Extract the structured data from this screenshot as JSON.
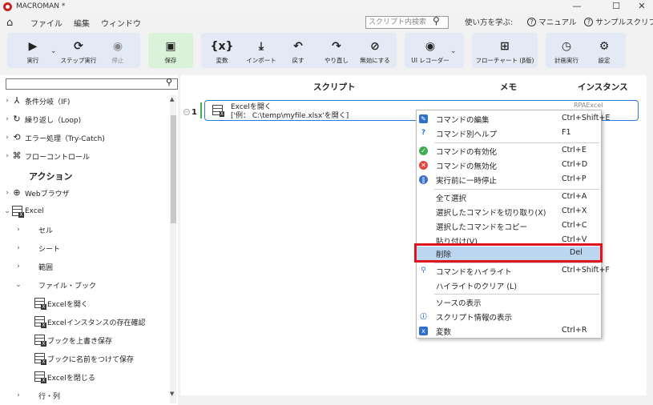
{
  "window": {
    "title": "MACROMAN *",
    "controls": [
      "—",
      "☐",
      "✕"
    ]
  },
  "menubar": {
    "items": [
      "ファイル",
      "編集",
      "ウィンドウ"
    ],
    "search_placeholder": "スクリプト内検索",
    "learn_label": "使い方を学ぶ:",
    "manual_label": "マニュアル",
    "sample_label": "サンプルスクリプト"
  },
  "toolbar": {
    "run": "実行",
    "step_run": "ステップ実行",
    "stop": "停止",
    "save": "保存",
    "variables": "変数",
    "import": "インポート",
    "undo": "戻す",
    "redo": "やり直し",
    "disable": "無効にする",
    "ui_recorder": "UI レコーダー",
    "flowchart": "フローチャート (β版)",
    "schedule": "計画実行",
    "settings": "設定"
  },
  "leftpanel": {
    "categories": [
      "条件分岐（IF)",
      "繰り返し（Loop)",
      "エラー処理（Try-Catch)",
      "フローコントロール"
    ],
    "actions_title": "アクション",
    "web_browser": "Webブラウザ",
    "excel": "Excel",
    "excel_children": [
      "セル",
      "シート",
      "範囲",
      "ファイル・ブック"
    ],
    "file_book_children": [
      "Excelを開く",
      "Excelインスタンスの存在確認",
      "ブックを上書き保存",
      "ブックに名前をつけて保存",
      "Excelを閉じる"
    ],
    "rows_cols": "行・列"
  },
  "script": {
    "col_script": "スクリプト",
    "col_memo": "メモ",
    "col_instance": "インスタンス",
    "line_number": "1",
    "command_title": "Excelを開く",
    "command_param": "['例： C:\\temp\\myfile.xlsx'を開く]",
    "instance": "RPAExcel"
  },
  "context_menu": {
    "items": [
      {
        "label": "コマンドの編集",
        "shortcut": "Ctrl+Shift+E"
      },
      {
        "label": "コマンド別ヘルプ",
        "shortcut": "F1"
      },
      {
        "label": "コマンドの有効化",
        "shortcut": "Ctrl+E"
      },
      {
        "label": "コマンドの無効化",
        "shortcut": "Ctrl+D"
      },
      {
        "label": "実行前に一時停止",
        "shortcut": "Ctrl+P"
      },
      {
        "label": "全て選択",
        "shortcut": "Ctrl+A"
      },
      {
        "label": "選択したコマンドを切り取り(X)",
        "shortcut": "Ctrl+X"
      },
      {
        "label": "選択したコマンドをコピー",
        "shortcut": "Ctrl+C"
      },
      {
        "label": "貼り付け(V)",
        "shortcut": "Ctrl+V"
      },
      {
        "label": "削除",
        "shortcut": "Del"
      },
      {
        "label": "コマンドをハイライト",
        "shortcut": "Ctrl+Shift+F"
      },
      {
        "label": "ハイライトのクリア (L)",
        "shortcut": ""
      },
      {
        "label": "ソースの表示",
        "shortcut": ""
      },
      {
        "label": "スクリプト情報の表示",
        "shortcut": ""
      },
      {
        "label": "変数",
        "shortcut": "Ctrl+R"
      }
    ],
    "highlighted": "削除"
  },
  "colors": {
    "accent_blue": "#2b7ad6",
    "highlight_frame": "#e0141e",
    "save_group": "#d9f2d9",
    "toolbar_group": "#e4eaf5"
  }
}
